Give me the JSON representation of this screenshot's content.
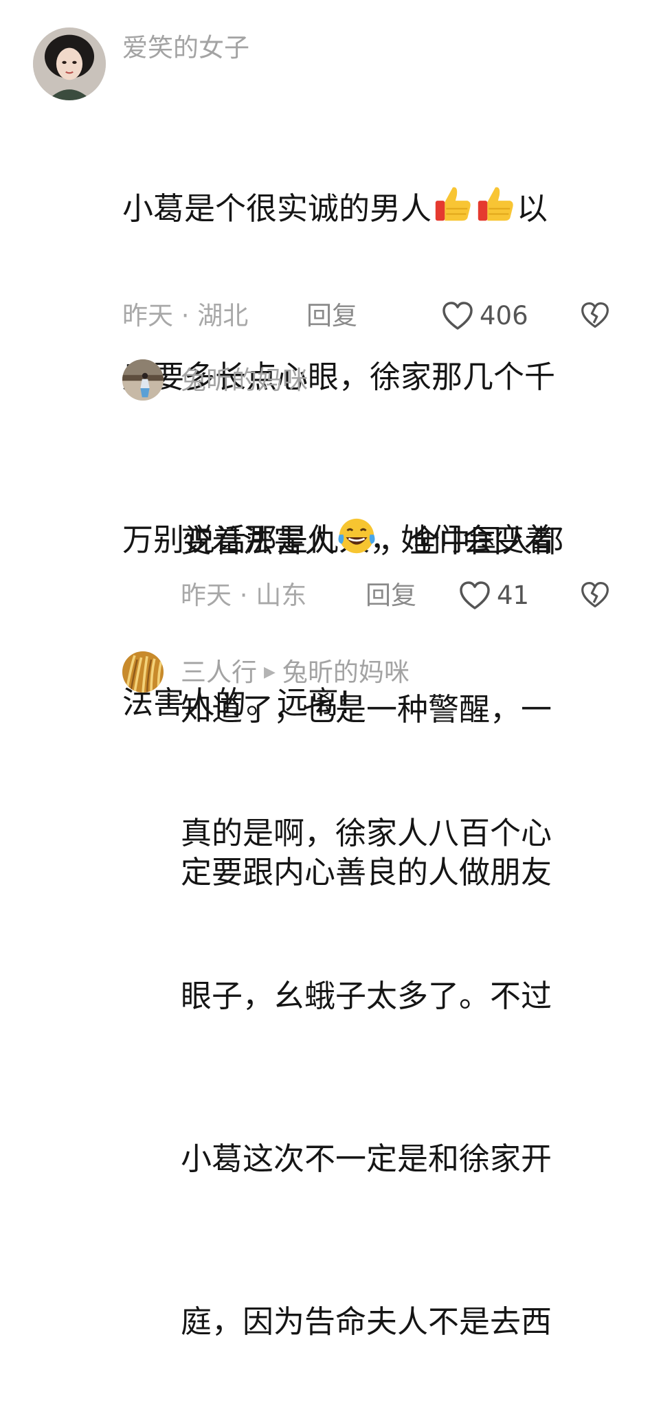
{
  "comments": [
    {
      "username": "爱笑的女子",
      "lines": [
        "小葛是个很实诚的男人",
        "后要多长点心眼，徐家那几个千",
        "万别说话那是仇人，她们会变着",
        "法害人的。远离!"
      ],
      "line1_suffix": "以",
      "emoji_line1": [
        "thumbs-up-icon",
        "thumbs-up-icon"
      ],
      "meta": "昨天 · 湖北",
      "reply_label": "回复",
      "likes": "406"
    },
    {
      "username": "兔昕的妈咪",
      "lines": [
        "变着法害人",
        "知道了，也是一种警醒，一",
        "定要跟内心善良的人做朋友"
      ],
      "line1_suffix": "，全中国人都",
      "emoji_line1": [
        "crying-laughing-icon"
      ],
      "meta": "昨天 · 山东",
      "reply_label": "回复",
      "likes": "41"
    },
    {
      "username": "三人行",
      "reply_to": "兔昕的妈咪",
      "lines": [
        "真的是啊，徐家人八百个心",
        "眼子，幺蛾子太多了。不过",
        "小葛这次不一定是和徐家开",
        "庭，因为告命夫人不是去西"
      ]
    }
  ],
  "colors": {
    "username": "#a3a3a3",
    "meta": "#a8a8a8",
    "text": "#151515"
  }
}
